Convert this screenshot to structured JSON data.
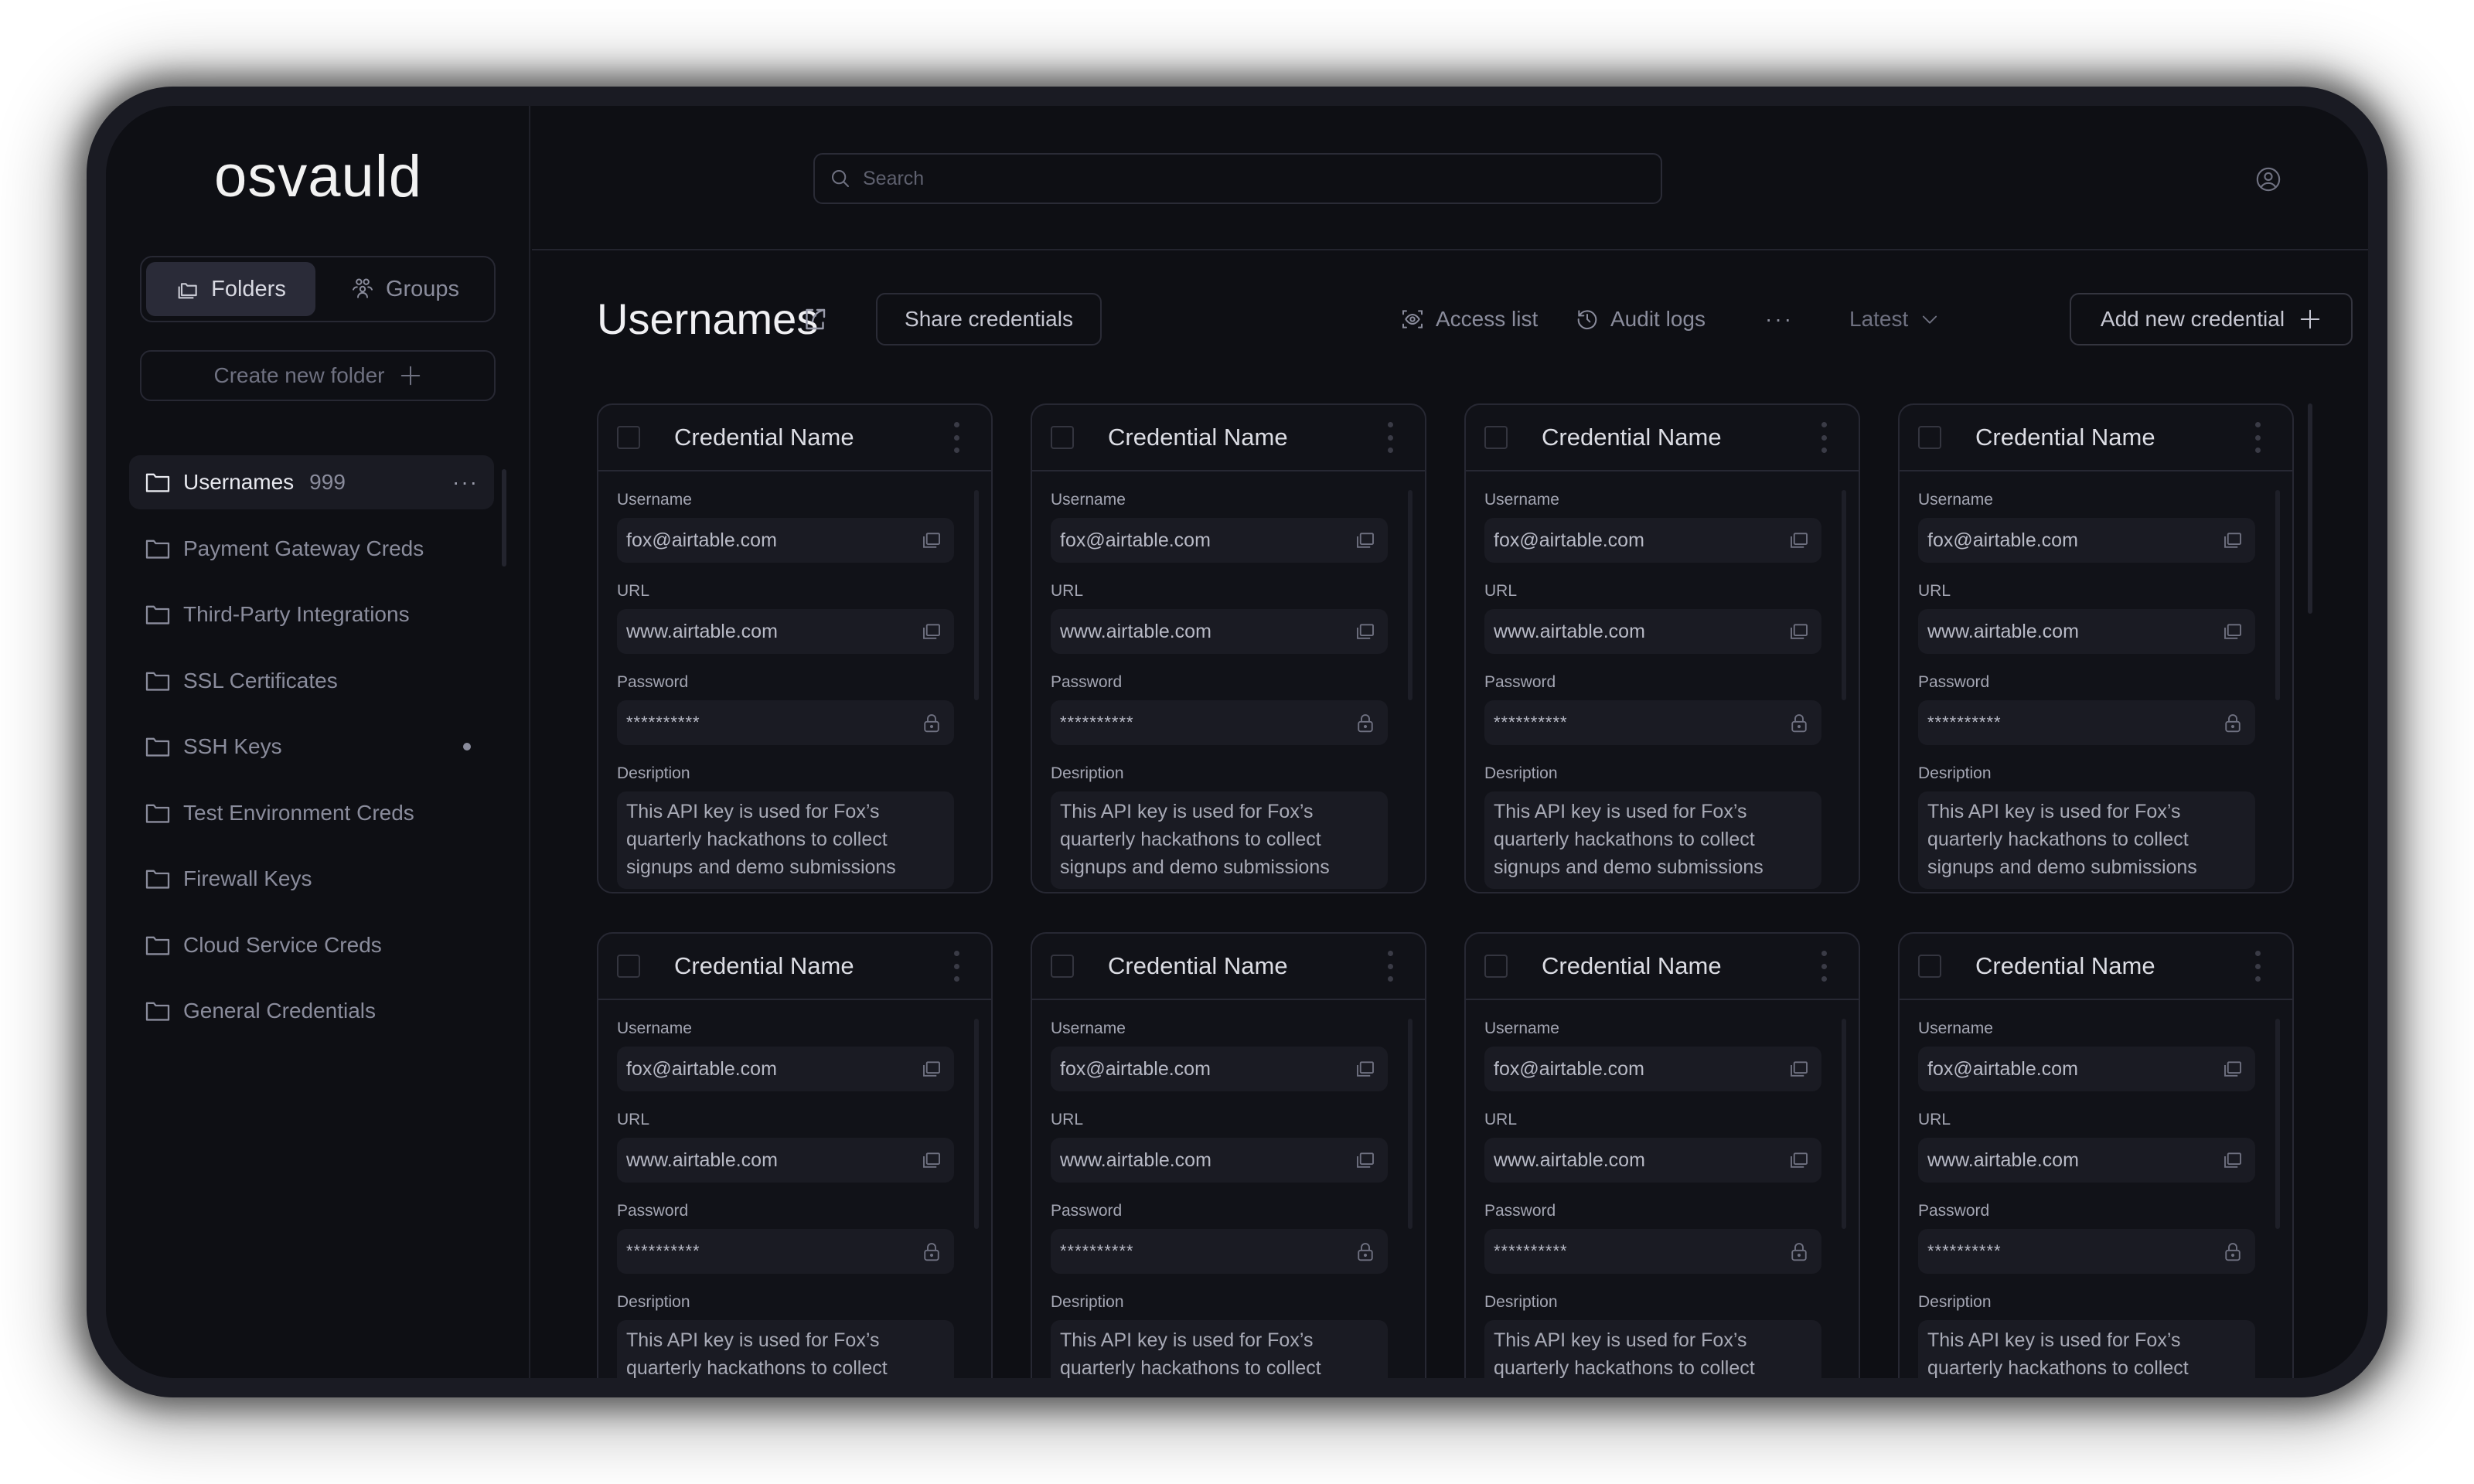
{
  "app": {
    "logo": "osvauld"
  },
  "sidebar": {
    "toggle": {
      "folders_label": "Folders",
      "groups_label": "Groups",
      "active": "Folders"
    },
    "create_folder_label": "Create new folder",
    "folders": [
      {
        "label": "Usernames",
        "count": "999",
        "active": true
      },
      {
        "label": "Payment Gateway Creds"
      },
      {
        "label": "Third-Party Integrations"
      },
      {
        "label": "SSL Certificates"
      },
      {
        "label": "SSH Keys",
        "indicator": true
      },
      {
        "label": "Test Environment Creds"
      },
      {
        "label": "Firewall Keys"
      },
      {
        "label": "Cloud Service Creds"
      },
      {
        "label": "General Credentials"
      }
    ],
    "more_label": "···"
  },
  "topbar": {
    "search_placeholder": "Search",
    "search_value": ""
  },
  "header": {
    "title": "Usernames",
    "share_credentials_label": "Share credentials",
    "access_list_label": "Access list",
    "audit_logs_label": "Audit logs",
    "more_label": "···",
    "sort_label": "Latest",
    "add_credential_label": "Add new credential"
  },
  "card_labels": {
    "username": "Username",
    "url": "URL",
    "password": "Password",
    "description": "Desription"
  },
  "credentials": [
    {
      "name": "Credential Name",
      "username": "fox@airtable.com",
      "url": "www.airtable.com",
      "password": "**********",
      "description": "This API key is used for Fox’s quarterly hackathons to collect signups and demo submissions"
    },
    {
      "name": "Credential Name",
      "username": "fox@airtable.com",
      "url": "www.airtable.com",
      "password": "**********",
      "description": "This API key is used for Fox’s quarterly hackathons to collect signups and demo submissions"
    },
    {
      "name": "Credential Name",
      "username": "fox@airtable.com",
      "url": "www.airtable.com",
      "password": "**********",
      "description": "This API key is used for Fox’s quarterly hackathons to collect signups and demo submissions"
    },
    {
      "name": "Credential Name",
      "username": "fox@airtable.com",
      "url": "www.airtable.com",
      "password": "**********",
      "description": "This API key is used for Fox’s quarterly hackathons to collect signups and demo submissions"
    },
    {
      "name": "Credential Name",
      "username": "fox@airtable.com",
      "url": "www.airtable.com",
      "password": "**********",
      "description": "This API key is used for Fox’s quarterly hackathons to collect signups and demo submissions"
    },
    {
      "name": "Credential Name",
      "username": "fox@airtable.com",
      "url": "www.airtable.com",
      "password": "**********",
      "description": "This API key is used for Fox’s quarterly hackathons to collect signups and demo submissions"
    },
    {
      "name": "Credential Name",
      "username": "fox@airtable.com",
      "url": "www.airtable.com",
      "password": "**********",
      "description": "This API key is used for Fox’s quarterly hackathons to collect signups and demo submissions"
    },
    {
      "name": "Credential Name",
      "username": "fox@airtable.com",
      "url": "www.airtable.com",
      "password": "**********",
      "description": "This API key is used for Fox’s quarterly hackathons to collect signups and demo submissions"
    }
  ],
  "icons": {
    "folders_tab": "folders-icon",
    "groups_tab": "users-group-icon",
    "create_folder": "plus-icon",
    "folder": "folder-icon",
    "search": "search-icon",
    "user": "user-circle-icon",
    "share": "share-icon",
    "access_list": "eye-scan-icon",
    "audit_logs": "history-clock-icon",
    "sort": "chevron-down-icon",
    "add": "plus-icon",
    "copy": "copy-icon",
    "lock": "lock-icon",
    "card_menu": "kebab-menu-icon"
  },
  "colors": {
    "background": "#0e0f14",
    "bezel": "#1a1b23",
    "border": "#272833",
    "field_bg": "#1a1b23",
    "text_primary": "#f0f0f3",
    "text_muted": "#8a8c9c"
  }
}
